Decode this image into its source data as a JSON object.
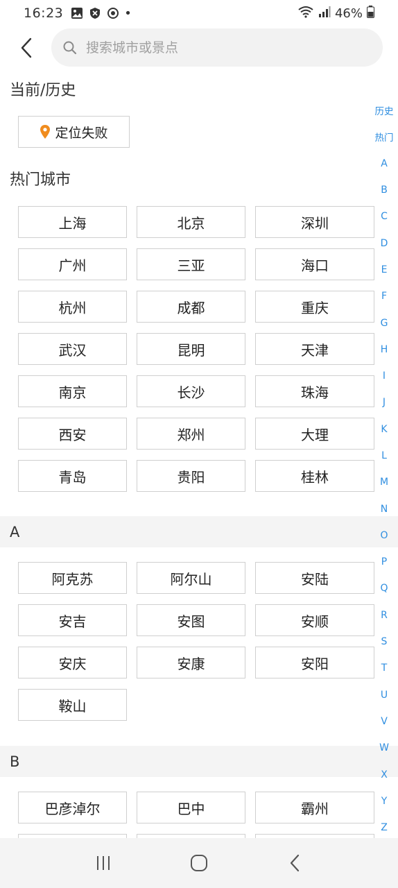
{
  "status": {
    "time": "16:23",
    "battery": "46%",
    "dot": "•"
  },
  "search": {
    "placeholder": "搜索城市或景点",
    "value": ""
  },
  "current_section": {
    "title": "当前/历史",
    "locate_label": "定位失败"
  },
  "hot_section": {
    "title": "热门城市",
    "cities": [
      "上海",
      "北京",
      "深圳",
      "广州",
      "三亚",
      "海口",
      "杭州",
      "成都",
      "重庆",
      "武汉",
      "昆明",
      "天津",
      "南京",
      "长沙",
      "珠海",
      "西安",
      "郑州",
      "大理",
      "青岛",
      "贵阳",
      "桂林"
    ]
  },
  "sections": [
    {
      "letter": "A",
      "cities": [
        "阿克苏",
        "阿尔山",
        "安陆",
        "安吉",
        "安图",
        "安顺",
        "安庆",
        "安康",
        "安阳",
        "鞍山"
      ]
    },
    {
      "letter": "B",
      "cities": [
        "巴彦淖尔",
        "巴中",
        "霸州"
      ]
    }
  ],
  "index": [
    "历史",
    "热门",
    "A",
    "B",
    "C",
    "D",
    "E",
    "F",
    "G",
    "H",
    "I",
    "J",
    "K",
    "L",
    "M",
    "N",
    "O",
    "P",
    "Q",
    "R",
    "S",
    "T",
    "U",
    "V",
    "W",
    "X",
    "Y",
    "Z"
  ],
  "colors": {
    "accent": "#2f8ee0",
    "pin": "#f08c1e",
    "section_bg": "#f4f4f4"
  }
}
